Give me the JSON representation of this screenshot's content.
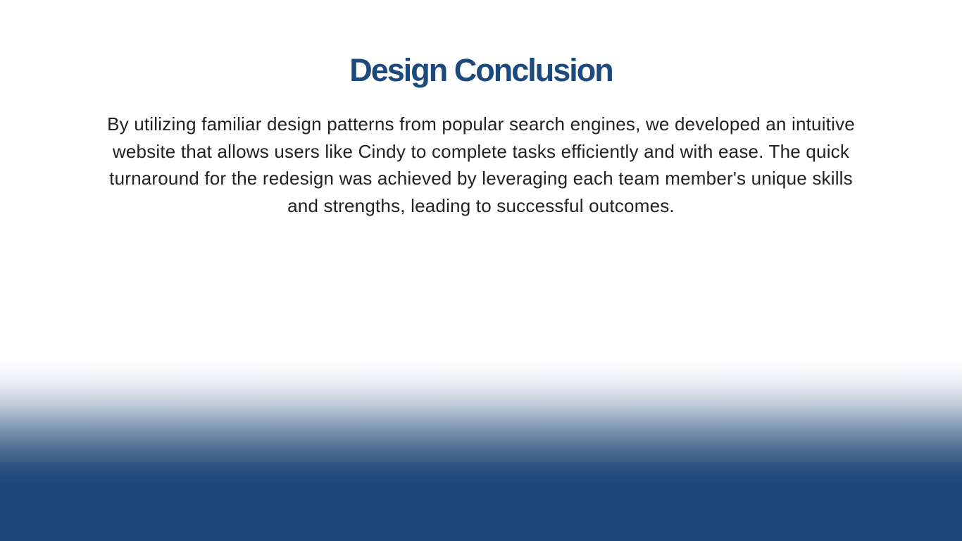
{
  "slide": {
    "title": "Design Conclusion",
    "body": "By utilizing familiar design patterns from popular search engines, we developed an intuitive website that allows users like Cindy to complete tasks efficiently and with ease. The quick turnaround for the redesign was achieved by leveraging each team member's unique skills and strengths, leading to successful outcomes."
  },
  "colors": {
    "title": "#1c4a7c",
    "body_text": "#222222",
    "gradient_bottom": "#1a4777",
    "background": "#ffffff"
  }
}
